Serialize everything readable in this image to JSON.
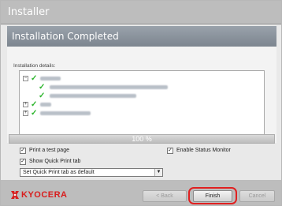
{
  "window": {
    "title": "Installer"
  },
  "header": {
    "title": "Installation Completed"
  },
  "details": {
    "label": "Installation details:",
    "items": [
      {
        "state": "expanded",
        "icon": "checkmark-icon"
      },
      {
        "state": "leaf",
        "icon": "checkmark-icon"
      },
      {
        "state": "leaf",
        "icon": "checkmark-icon"
      },
      {
        "state": "collapsed",
        "icon": "checkmark-icon"
      },
      {
        "state": "collapsed",
        "icon": "checkmark-icon"
      }
    ]
  },
  "progress": {
    "label": "100 %",
    "percent": 100
  },
  "options": {
    "print_test_page": {
      "label": "Print a test page",
      "checked": true
    },
    "enable_status_monitor": {
      "label": "Enable Status Monitor",
      "checked": true
    },
    "show_quick_print": {
      "label": "Show Quick Print tab",
      "checked": true
    },
    "quick_print_default": {
      "value": "Set Quick Print tab as default"
    }
  },
  "footer": {
    "brand": "KYOCERA",
    "back_label": "< Back",
    "finish_label": "Finish",
    "cancel_label": "Cancel"
  },
  "colors": {
    "brand_red": "#d81e1e",
    "check_green": "#2db52d",
    "highlight_ring": "#e02020"
  }
}
